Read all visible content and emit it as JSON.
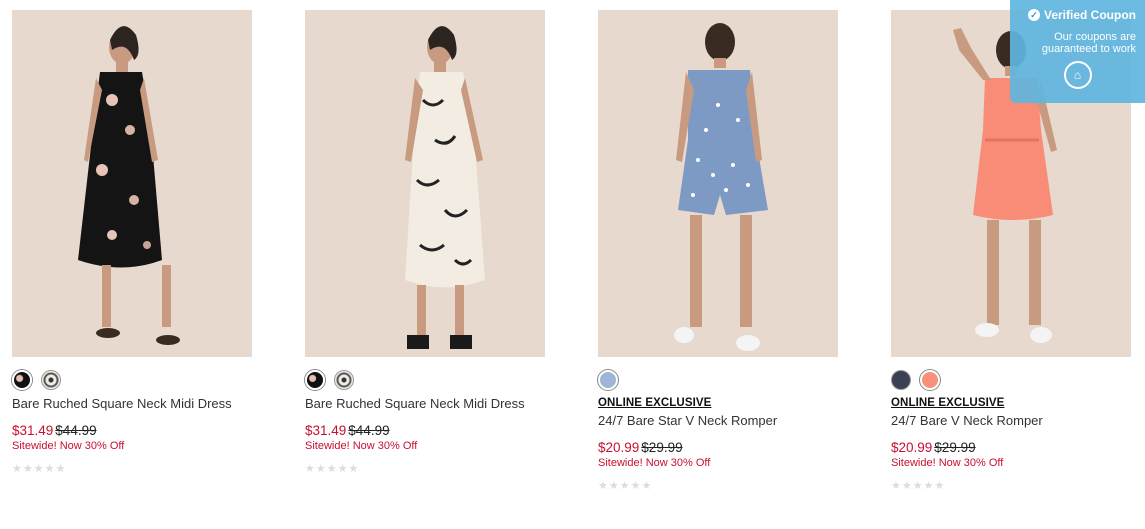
{
  "products": [
    {
      "name": "Bare Ruched Square Neck Midi Dress",
      "sale_price": "$31.49",
      "original_price": "$44.99",
      "promo": "Sitewide! Now 30% Off",
      "rating_stars": "★★★★★",
      "badge": "",
      "swatches": [
        "black-floral",
        "white-floral"
      ]
    },
    {
      "name": "Bare Ruched Square Neck Midi Dress",
      "sale_price": "$31.49",
      "original_price": "$44.99",
      "promo": "Sitewide! Now 30% Off",
      "rating_stars": "★★★★★",
      "badge": "",
      "swatches": [
        "black-floral",
        "white-floral"
      ]
    },
    {
      "name": "24/7 Bare Star V Neck Romper",
      "sale_price": "$20.99",
      "original_price": "$29.99",
      "promo": "Sitewide! Now 30% Off",
      "rating_stars": "★★★★★",
      "badge": "ONLINE EXCLUSIVE",
      "swatches": [
        "light-blue"
      ]
    },
    {
      "name": "24/7 Bare V Neck Romper",
      "sale_price": "$20.99",
      "original_price": "$29.99",
      "promo": "Sitewide! Now 30% Off",
      "rating_stars": "★★★★★",
      "badge": "ONLINE EXCLUSIVE",
      "swatches": [
        "navy",
        "coral"
      ]
    }
  ],
  "coupon": {
    "title": "Verified Coupon",
    "subtitle": "Our coupons are guaranteed to work",
    "icon": "home-icon"
  },
  "colors": {
    "sale": "#c8102e",
    "coupon_bg": "#5fb5e0",
    "photo_bg": "#e7d9cd"
  }
}
